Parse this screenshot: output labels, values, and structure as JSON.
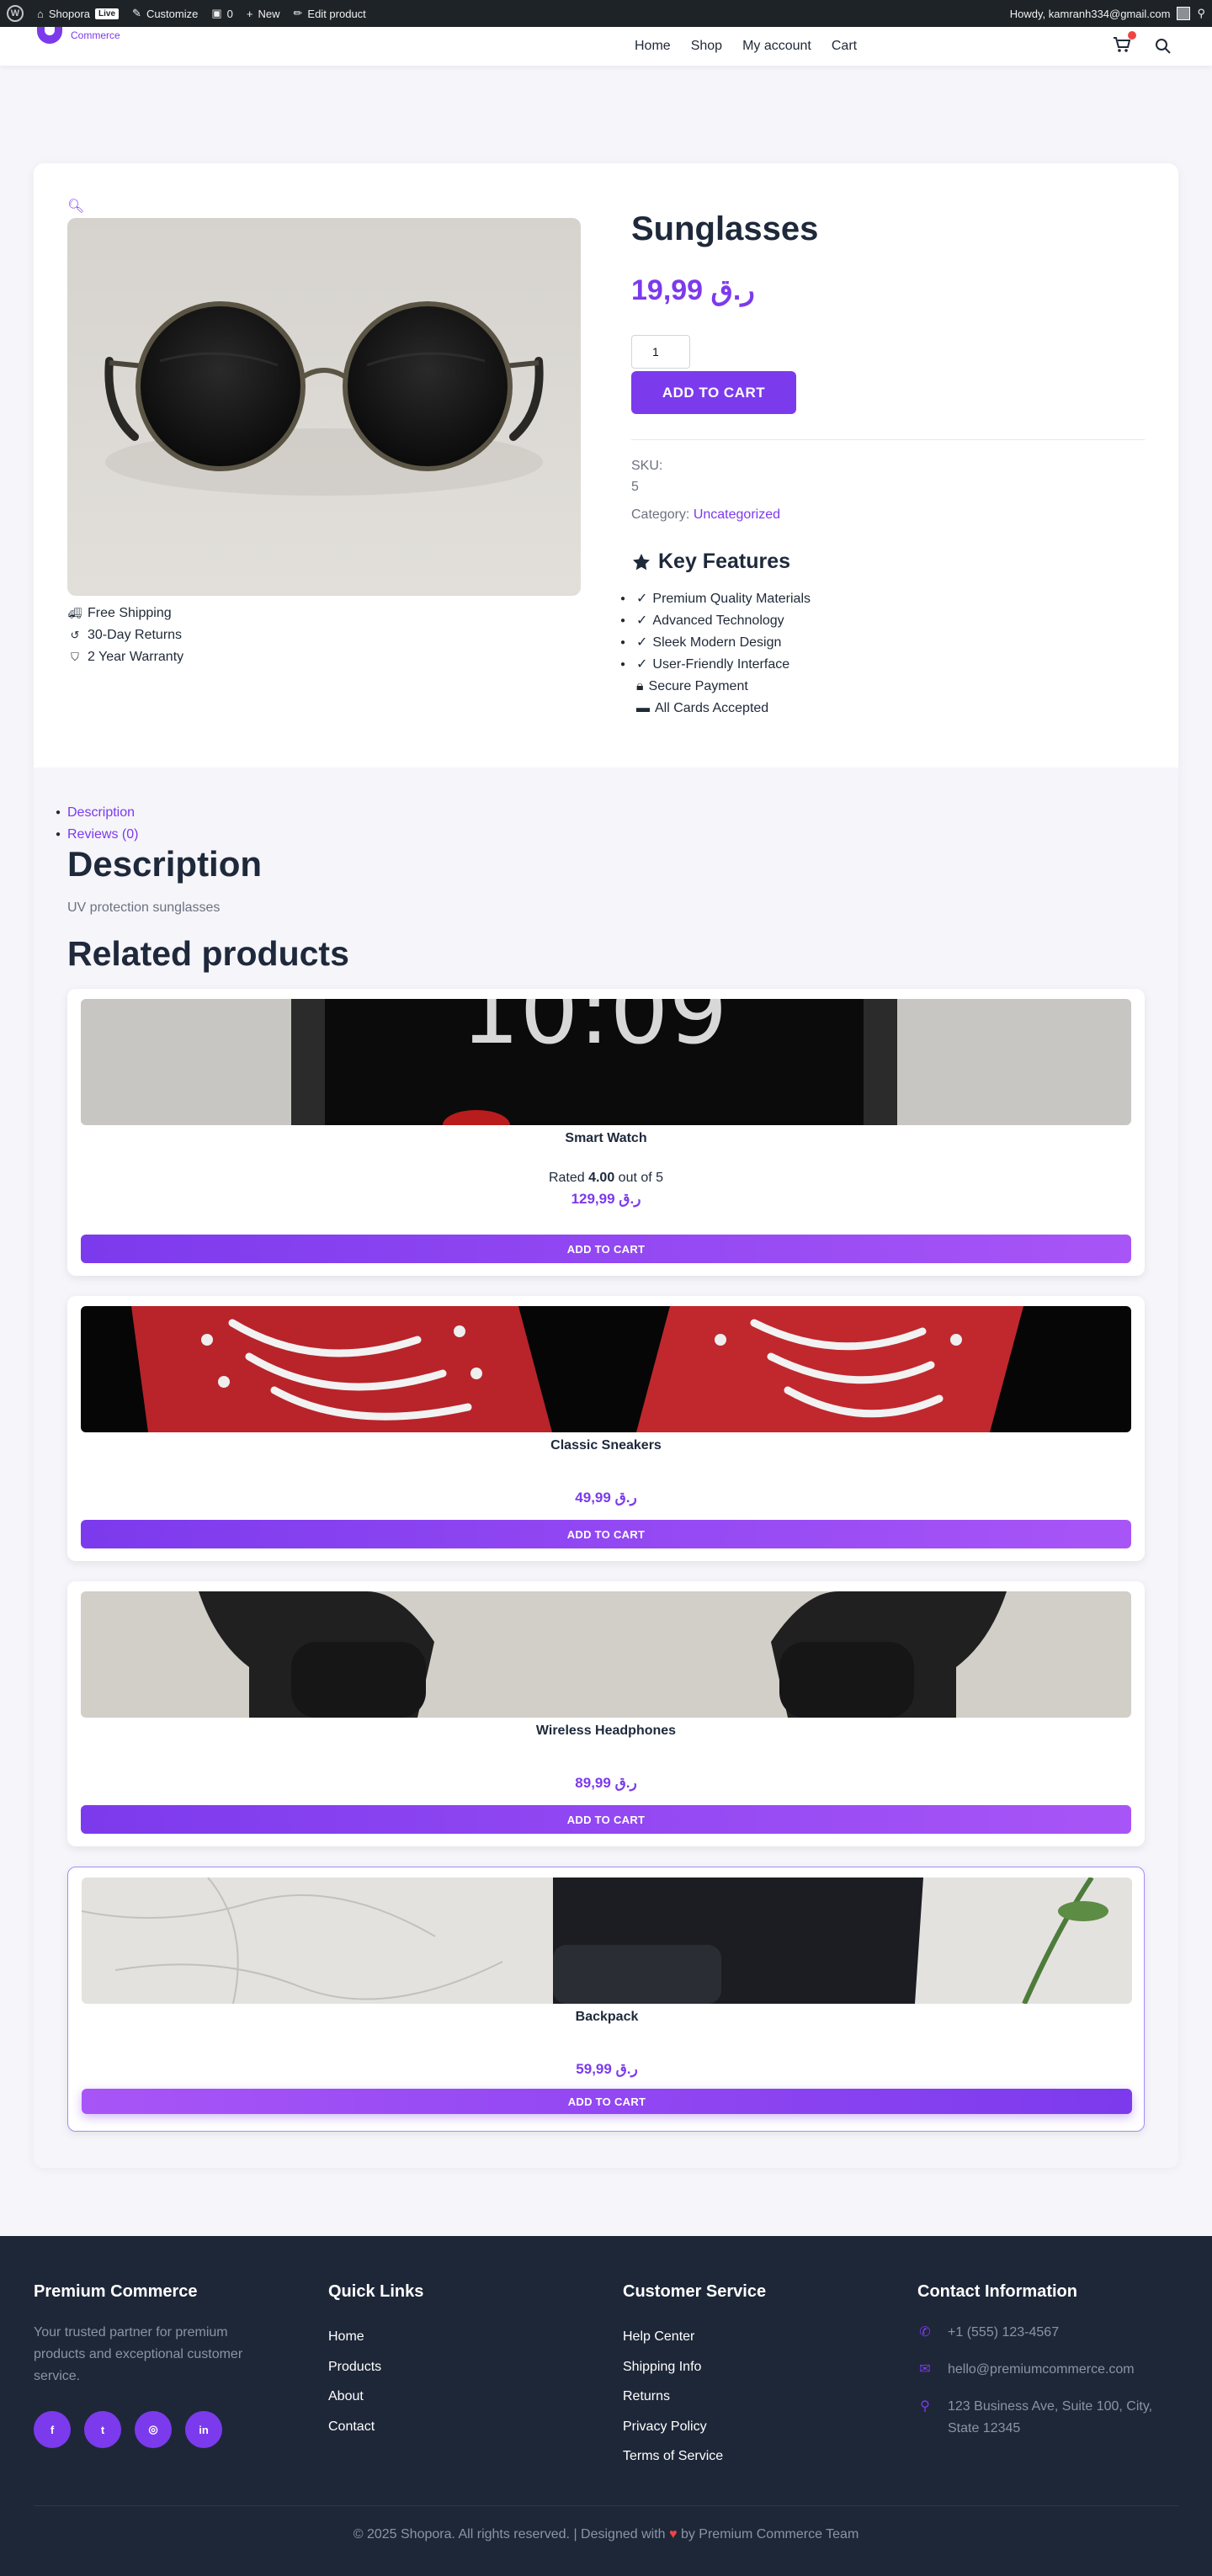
{
  "adminbar": {
    "site_name": "Shopora",
    "live_badge": "Live",
    "customize": "Customize",
    "comments_count": "0",
    "new_label": "New",
    "edit_product": "Edit product",
    "howdy": "Howdy, kamranh334@gmail.com"
  },
  "header": {
    "logo_sub": "Commerce",
    "nav": [
      "Home",
      "Shop",
      "My account",
      "Cart"
    ]
  },
  "product": {
    "title": "Sunglasses",
    "price": "19,99 ر.ق",
    "quantity": "1",
    "add_to_cart": "ADD TO CART",
    "sku_label": "SKU:",
    "sku_value": "5",
    "category_label": "Category:",
    "category_value": "Uncategorized",
    "trust_features": [
      "Free Shipping",
      "30-Day Returns",
      "2 Year Warranty"
    ],
    "key_features_title": "Key Features",
    "key_features": [
      "Premium Quality Materials",
      "Advanced Technology",
      "Sleek Modern Design",
      "User-Friendly Interface"
    ],
    "payment_features": [
      "Secure Payment",
      "All Cards Accepted"
    ]
  },
  "tabs": [
    "Description",
    "Reviews (0)"
  ],
  "description": {
    "title": "Description",
    "text": "UV protection sunglasses"
  },
  "related": {
    "title": "Related products",
    "items": [
      {
        "name": "Smart Watch",
        "rating_prefix": "Rated ",
        "rating": "4.00",
        "rating_suffix": " out of 5",
        "price": "129,99 ر.ق",
        "button": "ADD TO CART"
      },
      {
        "name": "Classic Sneakers",
        "price": "49,99 ر.ق",
        "button": "ADD TO CART"
      },
      {
        "name": "Wireless Headphones",
        "price": "89,99 ر.ق",
        "button": "ADD TO CART"
      },
      {
        "name": "Backpack",
        "price": "59,99 ر.ق",
        "button": "ADD TO CART"
      }
    ]
  },
  "footer": {
    "brand_title": "Premium Commerce",
    "brand_blurb": "Your trusted partner for premium products and exceptional customer service.",
    "quick_links_title": "Quick Links",
    "quick_links": [
      "Home",
      "Products",
      "About",
      "Contact"
    ],
    "service_title": "Customer Service",
    "service_links": [
      "Help Center",
      "Shipping Info",
      "Returns",
      "Privacy Policy",
      "Terms of Service"
    ],
    "contact_title": "Contact Information",
    "phone": "+1 (555) 123-4567",
    "email": "hello@premiumcommerce.com",
    "address": "123 Business Ave, Suite 100, City, State 12345",
    "copyright_left": "© 2025 Shopora. All rights reserved. | Designed with",
    "copyright_right": "by Premium Commerce Team"
  },
  "colors": {
    "accent": "#7c3aed",
    "footer_bg": "#1e2738",
    "adminbar_bg": "#1d2327"
  },
  "icons": [
    "wordpress-icon",
    "brush-icon",
    "comment-icon",
    "plus-icon",
    "pencil-icon",
    "search-icon",
    "cart-icon",
    "magnifier-icon",
    "truck-icon",
    "undo-icon",
    "shield-icon",
    "star-icon",
    "check-icon",
    "lock-icon",
    "card-icon",
    "facebook-icon",
    "twitter-icon",
    "instagram-icon",
    "linkedin-icon",
    "phone-icon",
    "mail-icon",
    "map-pin-icon",
    "heart-icon"
  ]
}
